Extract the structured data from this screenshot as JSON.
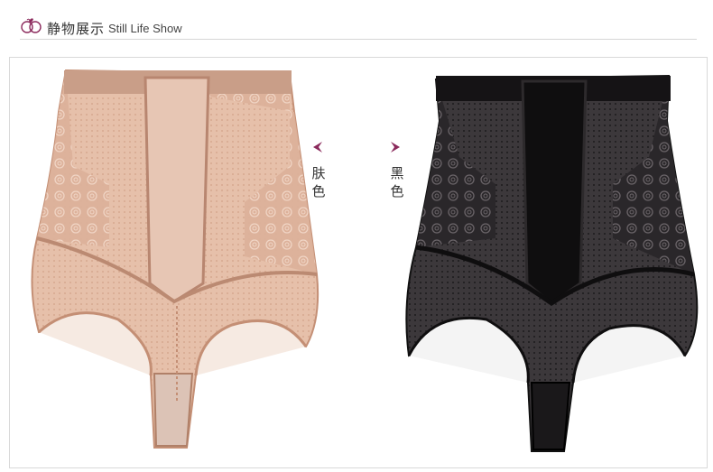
{
  "header": {
    "title_cn": "静物展示",
    "title_en": "Still Life Show"
  },
  "labels": {
    "skin_chars": [
      "肤",
      "色"
    ],
    "black_chars": [
      "黑",
      "色"
    ]
  },
  "colors": {
    "accent": "#8b2a5c",
    "skin": "#e2b9a2",
    "black": "#1c1a1c"
  }
}
